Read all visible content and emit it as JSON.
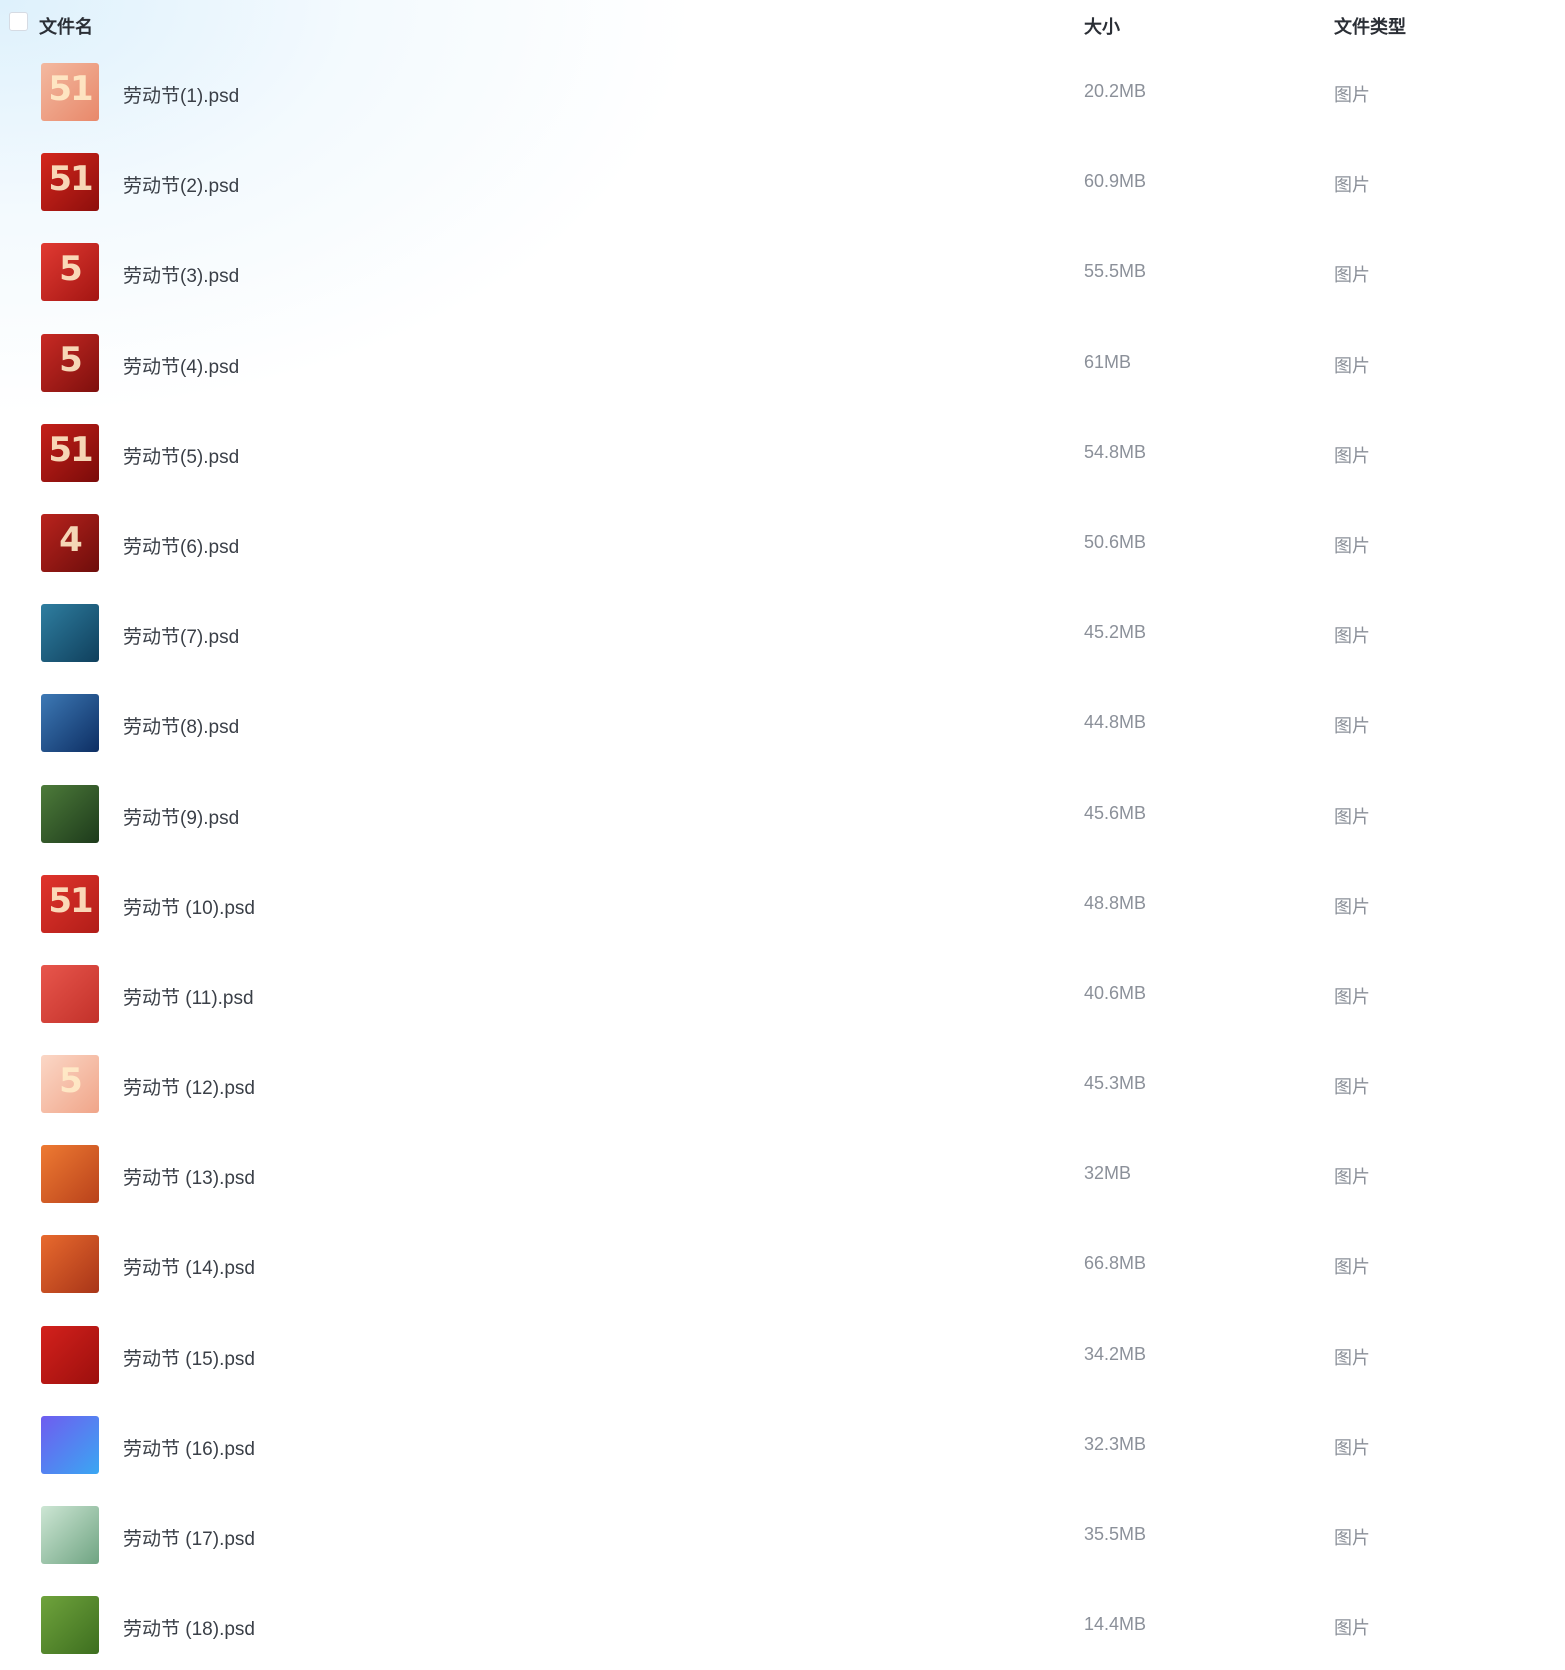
{
  "header": {
    "name_label": "文件名",
    "size_label": "大小",
    "type_label": "文件类型"
  },
  "files": [
    {
      "name": "劳动节(1).psd",
      "size": "20.2MB",
      "type": "图片",
      "thumb_colors": [
        "#f3b9a0",
        "#e8886a"
      ],
      "thumb_text": "51"
    },
    {
      "name": "劳动节(2).psd",
      "size": "60.9MB",
      "type": "图片",
      "thumb_colors": [
        "#d4271d",
        "#8d0e0c"
      ],
      "thumb_text": "51"
    },
    {
      "name": "劳动节(3).psd",
      "size": "55.5MB",
      "type": "图片",
      "thumb_colors": [
        "#e13a32",
        "#a31512"
      ],
      "thumb_text": "5"
    },
    {
      "name": "劳动节(4).psd",
      "size": "61MB",
      "type": "图片",
      "thumb_colors": [
        "#c82a24",
        "#7e0f0d"
      ],
      "thumb_text": "5"
    },
    {
      "name": "劳动节(5).psd",
      "size": "54.8MB",
      "type": "图片",
      "thumb_colors": [
        "#c5201a",
        "#7a0b09"
      ],
      "thumb_text": "51"
    },
    {
      "name": "劳动节(6).psd",
      "size": "50.6MB",
      "type": "图片",
      "thumb_colors": [
        "#b9231d",
        "#6e0d0b"
      ],
      "thumb_text": "4"
    },
    {
      "name": "劳动节(7).psd",
      "size": "45.2MB",
      "type": "图片",
      "thumb_colors": [
        "#2f7ea0",
        "#0f3f5c"
      ],
      "thumb_text": ""
    },
    {
      "name": "劳动节(8).psd",
      "size": "44.8MB",
      "type": "图片",
      "thumb_colors": [
        "#3d79b5",
        "#0d2e63"
      ],
      "thumb_text": ""
    },
    {
      "name": "劳动节(9).psd",
      "size": "45.6MB",
      "type": "图片",
      "thumb_colors": [
        "#4d7b3a",
        "#1d3a1b"
      ],
      "thumb_text": ""
    },
    {
      "name": "劳动节 (10).psd",
      "size": "48.8MB",
      "type": "图片",
      "thumb_colors": [
        "#e0342c",
        "#b11d18"
      ],
      "thumb_text": "51"
    },
    {
      "name": "劳动节 (11).psd",
      "size": "40.6MB",
      "type": "图片",
      "thumb_colors": [
        "#e8564c",
        "#c2312a"
      ],
      "thumb_text": ""
    },
    {
      "name": "劳动节 (12).psd",
      "size": "45.3MB",
      "type": "图片",
      "thumb_colors": [
        "#fbd7c6",
        "#f0a589"
      ],
      "thumb_text": "5"
    },
    {
      "name": "劳动节 (13).psd",
      "size": "32MB",
      "type": "图片",
      "thumb_colors": [
        "#ee7a32",
        "#b9421b"
      ],
      "thumb_text": ""
    },
    {
      "name": "劳动节 (14).psd",
      "size": "66.8MB",
      "type": "图片",
      "thumb_colors": [
        "#e86a2e",
        "#a83518"
      ],
      "thumb_text": ""
    },
    {
      "name": "劳动节 (15).psd",
      "size": "34.2MB",
      "type": "图片",
      "thumb_colors": [
        "#d3211c",
        "#9c0f0d"
      ],
      "thumb_text": ""
    },
    {
      "name": "劳动节 (16).psd",
      "size": "32.3MB",
      "type": "图片",
      "thumb_colors": [
        "#6f5cf0",
        "#3aa7f2"
      ],
      "thumb_text": ""
    },
    {
      "name": "劳动节 (17).psd",
      "size": "35.5MB",
      "type": "图片",
      "thumb_colors": [
        "#cde6d4",
        "#6fa482"
      ],
      "thumb_text": ""
    },
    {
      "name": "劳动节 (18).psd",
      "size": "14.4MB",
      "type": "图片",
      "thumb_colors": [
        "#6fa33c",
        "#3d6e1f"
      ],
      "thumb_text": ""
    }
  ]
}
